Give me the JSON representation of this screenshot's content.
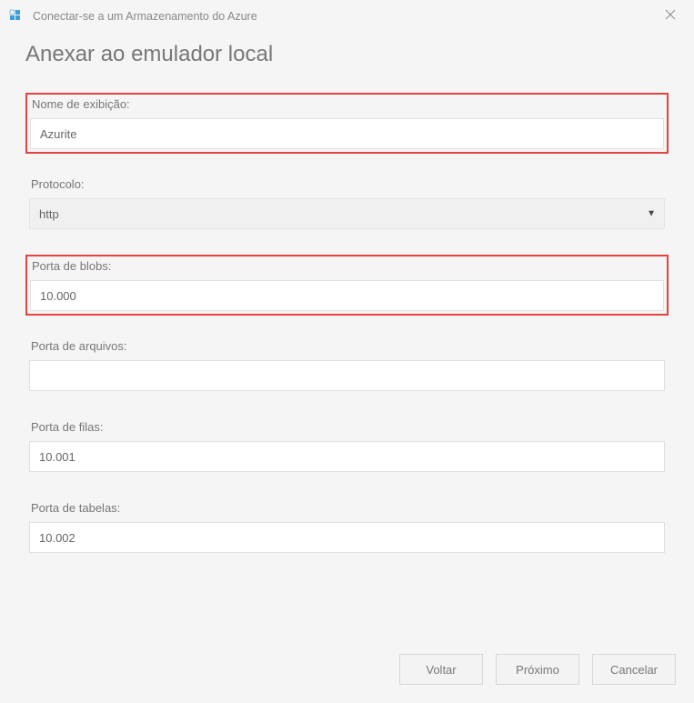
{
  "titlebar": {
    "title": "Conectar-se a um Armazenamento do Azure"
  },
  "page": {
    "heading": "Anexar ao emulador local"
  },
  "fields": {
    "displayName": {
      "label": "Nome de exibição:",
      "value": "Azurite"
    },
    "protocol": {
      "label": "Protocolo:",
      "value": "http"
    },
    "blobPort": {
      "label": "Porta de blobs:",
      "value": "10.000"
    },
    "filePort": {
      "label": "Porta de arquivos:",
      "value": ""
    },
    "queuePort": {
      "label": "Porta de filas:",
      "value": "10.001"
    },
    "tablePort": {
      "label": "Porta de tabelas:",
      "value": "10.002"
    }
  },
  "buttons": {
    "back": "Voltar",
    "next": "Próximo",
    "cancel": "Cancelar"
  }
}
